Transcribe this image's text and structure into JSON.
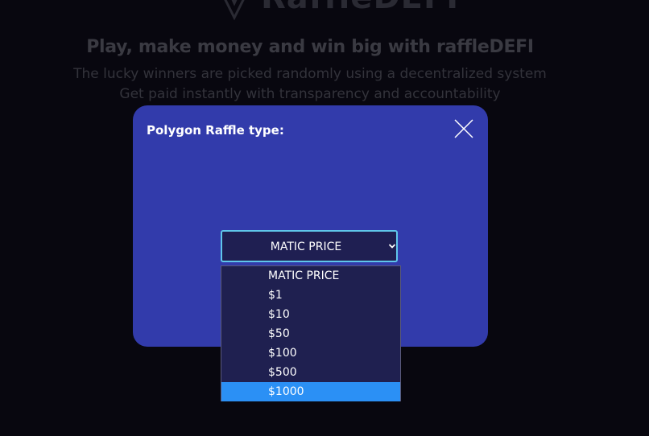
{
  "background": {
    "logo_text": "RaffleDEFI",
    "hero_title": "Play, make money and win big with raffleDEFI",
    "hero_line_1": "The lucky winners are picked randomly using a decentralized system",
    "hero_line_2": "Get paid instantly with transparency and accountability"
  },
  "modal": {
    "title": "Polygon Raffle type:",
    "select": {
      "selected_value": "MATIC PRICE",
      "options": [
        {
          "label": "MATIC PRICE"
        },
        {
          "label": "$1"
        },
        {
          "label": "$10"
        },
        {
          "label": "$50"
        },
        {
          "label": "$100"
        },
        {
          "label": "$500"
        },
        {
          "label": "$1000"
        }
      ],
      "highlighted_option": "$1000"
    }
  },
  "colors": {
    "page_background": "#08070f",
    "modal_background": "#323bab",
    "select_background": "#1f1f52",
    "select_border": "#5fc6ea",
    "option_highlight": "#2b90f5"
  }
}
